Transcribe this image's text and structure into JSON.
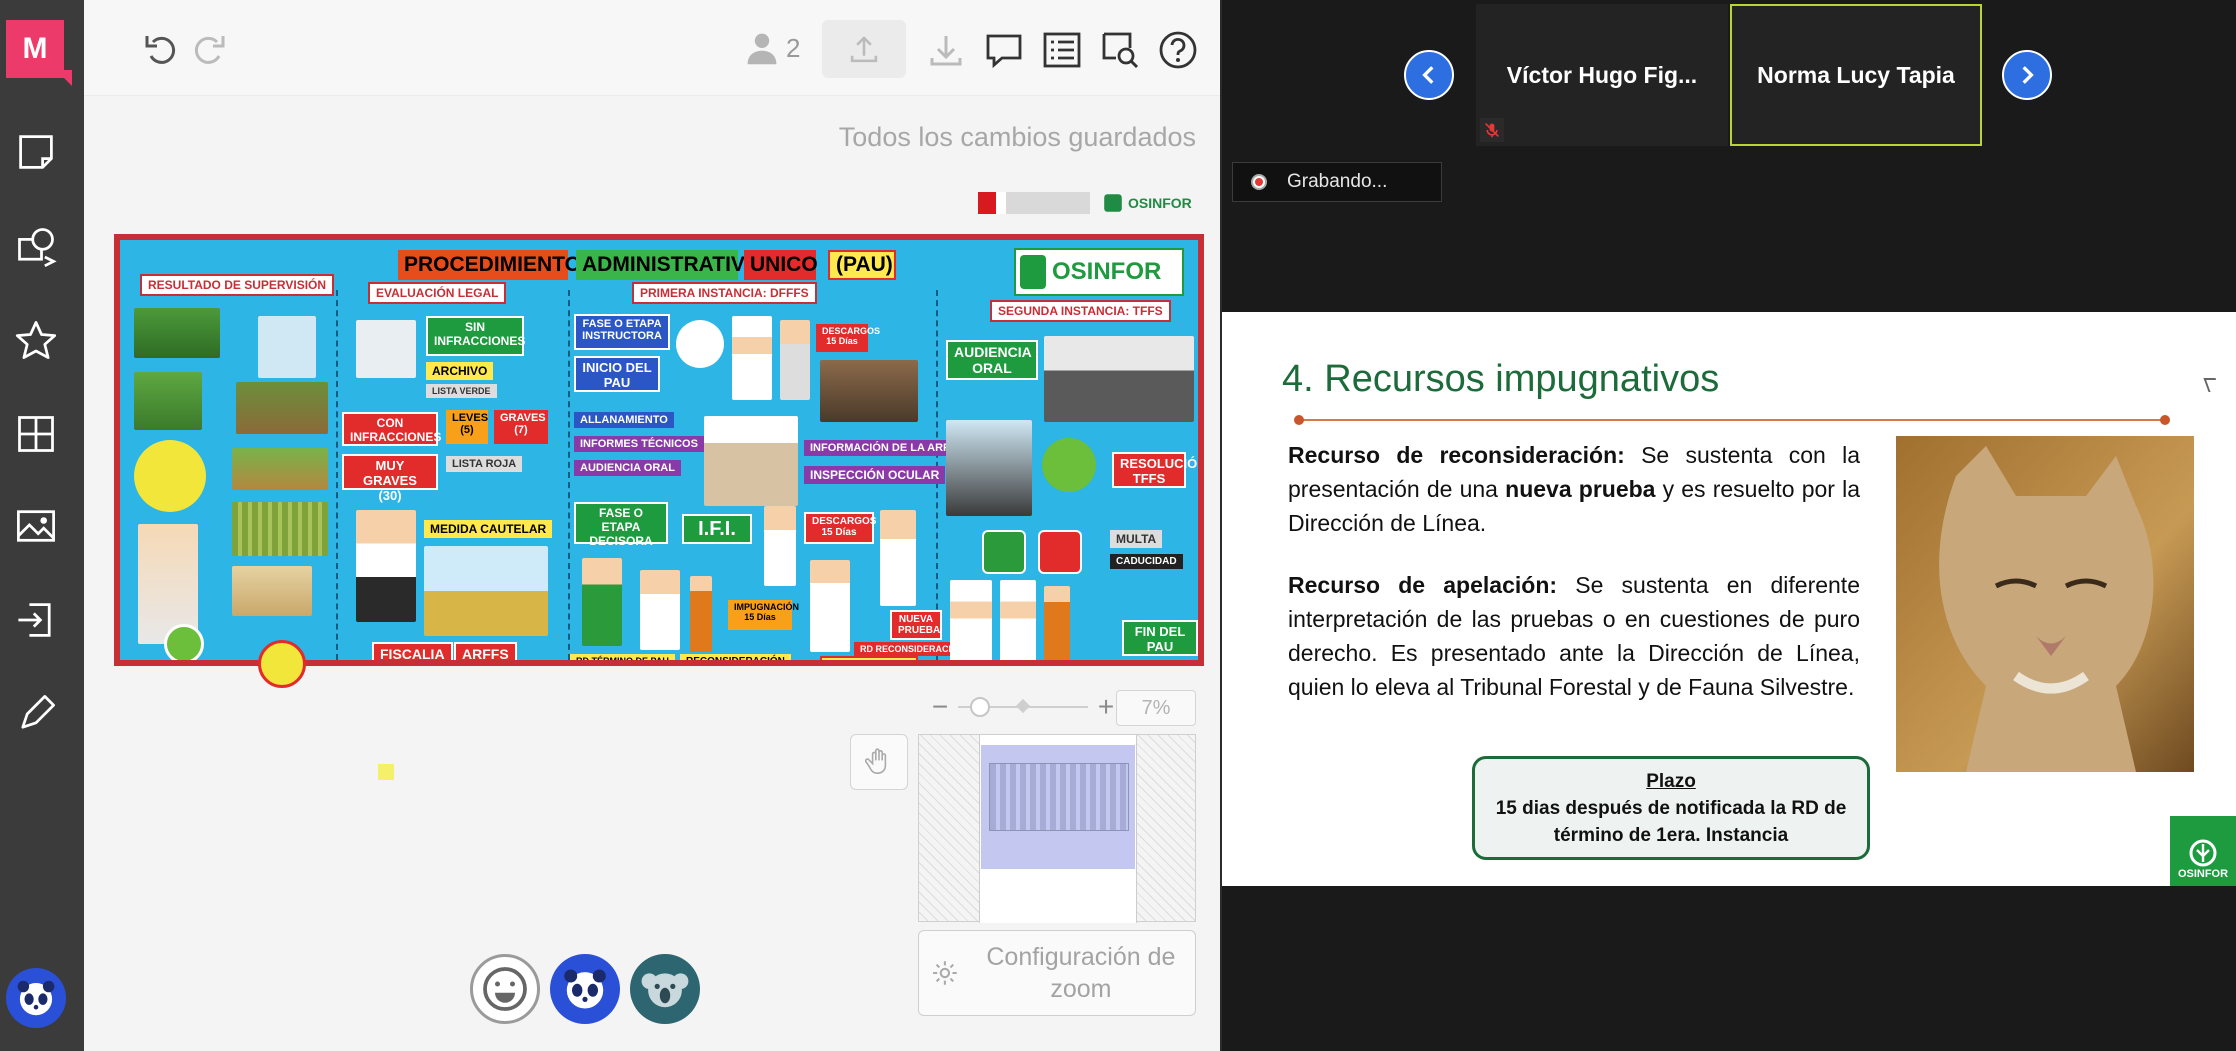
{
  "app": {
    "logo_letter": "M"
  },
  "topbar": {
    "user_count": "2"
  },
  "status": {
    "saved_text": "Todos los cambios guardados"
  },
  "poster": {
    "title_words": [
      "PROCEDIMIENTO",
      "ADMINISTRATIVO",
      "UNICO",
      "(PAU)"
    ],
    "brand": "OSINFOR",
    "tags": {
      "resultado": "RESULTADO DE SUPERVISIÓN",
      "evaluacion": "EVALUACIÓN LEGAL",
      "primera": "PRIMERA INSTANCIA: DFFFS",
      "segunda": "SEGUNDA INSTANCIA: TFFS",
      "sin_infracciones": "SIN INFRACCIONES",
      "archivo": "ARCHIVO",
      "lista_verde": "LISTA VERDE",
      "con_infracciones": "CON INFRACCIONES",
      "leves": "LEVES (5)",
      "graves": "GRAVES (7)",
      "muy_graves": "MUY GRAVES (30)",
      "lista_roja": "LISTA ROJA",
      "medida_cautelar": "MEDIDA CAUTELAR",
      "fiscalia": "FISCALIA",
      "arffs": "ARFFS",
      "fase_instructora": "FASE O ETAPA INSTRUCTORA",
      "inicio_pau": "INICIO DEL PAU",
      "descargos1": "DESCARGOS 15 Días",
      "allanamiento": "ALLANAMIENTO",
      "informes": "INFORMES TÉCNICOS",
      "audiencia_oral1": "AUDIENCIA ORAL",
      "info_arffs": "INFORMACIÓN DE LA ARFFS",
      "inspeccion": "INSPECCIÓN OCULAR",
      "fase_decisora": "FASE O ETAPA DECISORA",
      "ifi": "I.F.I.",
      "descargos2": "DESCARGOS 15 Días",
      "impugnacion": "IMPUGNACIÓN 15 Días",
      "nueva_prueba": "NUEVA PRUEBA",
      "rd_reconsideracion": "RD RECONSIDERACIÓN",
      "apelacion": "APELACIÓN",
      "rd_termino": "RD TÉRMINO DE PAU",
      "reconsideracion": "RECONSIDERACIÓN",
      "audiencia_oral2": "AUDIENCIA ORAL",
      "resolucion": "RESOLUCIÓN TFFS",
      "multa": "MULTA",
      "caducidad": "CADUCIDAD",
      "fin_pau": "FIN DEL PAU"
    }
  },
  "zoom": {
    "minus": "−",
    "plus": "+",
    "value": "7%",
    "config_label": "Configuración de zoom"
  },
  "meeting": {
    "participants": [
      {
        "name": "Víctor  Hugo  Fig...",
        "muted": true
      },
      {
        "name": "Norma Lucy Tapia",
        "active": true
      }
    ],
    "recording_label": "Grabando..."
  },
  "slide": {
    "title": "4. Recursos impugnativos",
    "p1_bold": "Recurso de reconsideración:",
    "p1_text_a": " Se sustenta con la presentación de una ",
    "p1_bold2": "nueva prueba",
    "p1_text_b": " y es resuelto por la Dirección de Línea.",
    "p2_bold": "Recurso de apelación:",
    "p2_text": " Se sustenta en diferente interpretación de las pruebas o en cuestiones de puro derecho. Es presentado ante la Dirección de Línea, quien lo eleva al Tribunal Forestal y de Fauna Silvestre.",
    "plazo_title": "Plazo",
    "plazo_line1": "15 dias después de notificada la RD de",
    "plazo_line2": "término de 1era. Instancia",
    "corner_brand": "OSINFOR"
  },
  "colors": {
    "logo_pink": "#ec3a6b",
    "poster_blue": "#2cb5e5",
    "slide_green": "#1d6b3a",
    "nav_blue": "#2d6fe0"
  }
}
